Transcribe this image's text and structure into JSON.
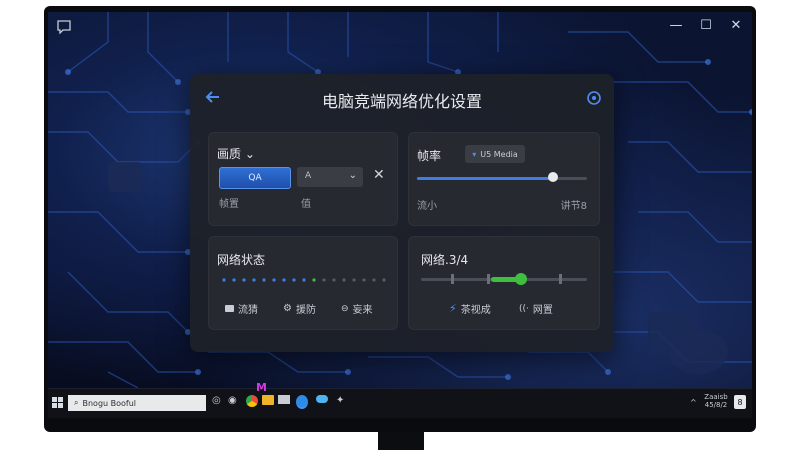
{
  "panel": {
    "title": "电脑竞端网络优化设置"
  },
  "quality_card": {
    "label": "画质",
    "button_label": "QA",
    "select_value": "A",
    "sub_left": "帧置",
    "sub_right": "值"
  },
  "framerate_card": {
    "label": "帧率",
    "badge": "U5 Media",
    "slider_fraction": 0.8,
    "min_label": "流小",
    "max_label": "讲节8"
  },
  "network_status_card": {
    "label": "网络状态",
    "items": [
      {
        "label": "流猜"
      },
      {
        "label": "援防"
      },
      {
        "label": "妄来"
      }
    ]
  },
  "network_card": {
    "label": "网络.3/4",
    "slider_fraction": 0.6,
    "items": [
      {
        "label": "茶视成"
      },
      {
        "label": "网置"
      }
    ]
  },
  "taskbar": {
    "search_text": "Bnogu Booful",
    "tray_line1": "Zaaisb",
    "tray_line2": "45/8/2",
    "notification_count": "8"
  },
  "colors": {
    "accent_blue": "#4f8ef0",
    "accent_green": "#3ec03e",
    "panel_bg": "#1e2128"
  }
}
